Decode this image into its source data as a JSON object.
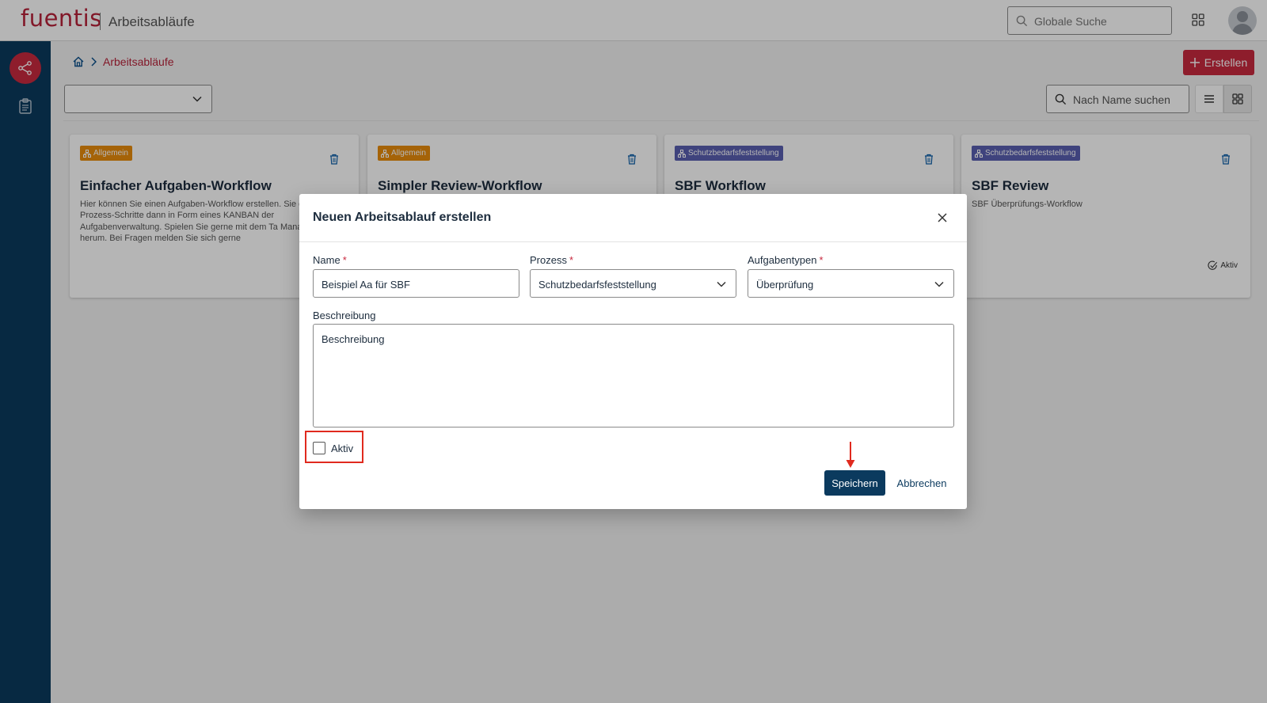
{
  "header": {
    "logo": "fuentis",
    "app_title": "Arbeitsabläufe",
    "global_search_placeholder": "Globale Suche"
  },
  "breadcrumb": {
    "current": "Arbeitsabläufe"
  },
  "toolbar": {
    "create_label": "Erstellen",
    "filter_value": "",
    "name_search_placeholder": "Nach Name suchen"
  },
  "cards": [
    {
      "tag": "Allgemein",
      "title": "Einfacher Aufgaben-Workflow",
      "description": "Hier können Sie einen Aufgaben-Workflow erstellen. Sie einzelnen Prozess-Schritte dann in Form eines KANBAN der Aufgabenverwaltung. Spielen Sie gerne mit dem Ta Management herum. Bei Fragen melden Sie sich gerne",
      "status": ""
    },
    {
      "tag": "Allgemein",
      "title": "Simpler Review-Workflow",
      "description": "",
      "status": ""
    },
    {
      "tag": "Schutzbedarfsfeststellung",
      "title": "SBF Workflow",
      "description": "",
      "status": ""
    },
    {
      "tag": "Schutzbedarfsfeststellung",
      "title": "SBF Review",
      "description": "SBF Überprüfungs-Workflow",
      "status": "Aktiv"
    }
  ],
  "dialog": {
    "title": "Neuen Arbeitsablauf erstellen",
    "name_label": "Name",
    "name_value": "Beispiel Aa für SBF",
    "prozess_label": "Prozess",
    "prozess_value": "Schutzbedarfsfeststellung",
    "aufgabentypen_label": "Aufgabentypen",
    "aufgabentypen_value": "Überprüfung",
    "required_marker": "*",
    "beschreibung_label": "Beschreibung",
    "beschreibung_value": "Beschreibung",
    "aktiv_label": "Aktiv",
    "aktiv_checked": false,
    "save_label": "Speichern",
    "cancel_label": "Abbrechen"
  },
  "colors": {
    "brand_red": "#c8293f",
    "navy": "#0b3a5e",
    "tag_orange": "#e98c0c",
    "tag_purple": "#5a5fb0",
    "highlight_red": "#e02a1e"
  },
  "icons": [
    "search-icon",
    "apps-grid-icon",
    "avatar-icon",
    "workflow-icon",
    "clipboard-icon",
    "home-icon",
    "chevron-right-icon",
    "plus-icon",
    "chevron-down-icon",
    "list-view-icon",
    "grid-view-icon",
    "hierarchy-icon",
    "trash-icon",
    "check-circle-icon",
    "close-icon",
    "arrow-down-icon"
  ]
}
